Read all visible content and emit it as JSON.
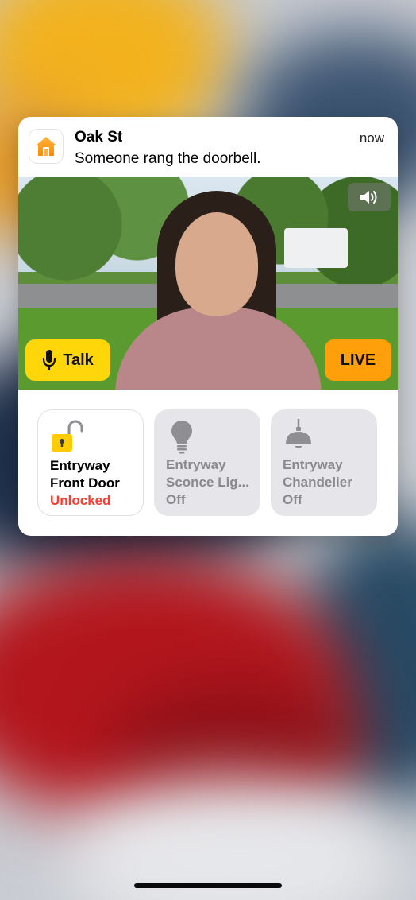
{
  "notification": {
    "title": "Oak St",
    "message": "Someone rang the doorbell.",
    "time": "now",
    "app_icon": "home-app-icon"
  },
  "camera": {
    "talk_label": "Talk",
    "live_label": "LIVE",
    "volume_icon": "speaker-icon"
  },
  "accessories": [
    {
      "name_line1": "Entryway",
      "name_line2": "Front Door",
      "status": "Unlocked",
      "icon": "lock-open-icon",
      "active": true
    },
    {
      "name_line1": "Entryway",
      "name_line2": "Sconce Lig...",
      "status": "Off",
      "icon": "lightbulb-icon",
      "active": false
    },
    {
      "name_line1": "Entryway",
      "name_line2": "Chandelier",
      "status": "Off",
      "icon": "pendant-lamp-icon",
      "active": false
    }
  ],
  "colors": {
    "talk_yellow": "#ffd60a",
    "live_orange": "#ff9f0a",
    "status_red": "#ff3b30",
    "home_orange": "#ff9500"
  }
}
